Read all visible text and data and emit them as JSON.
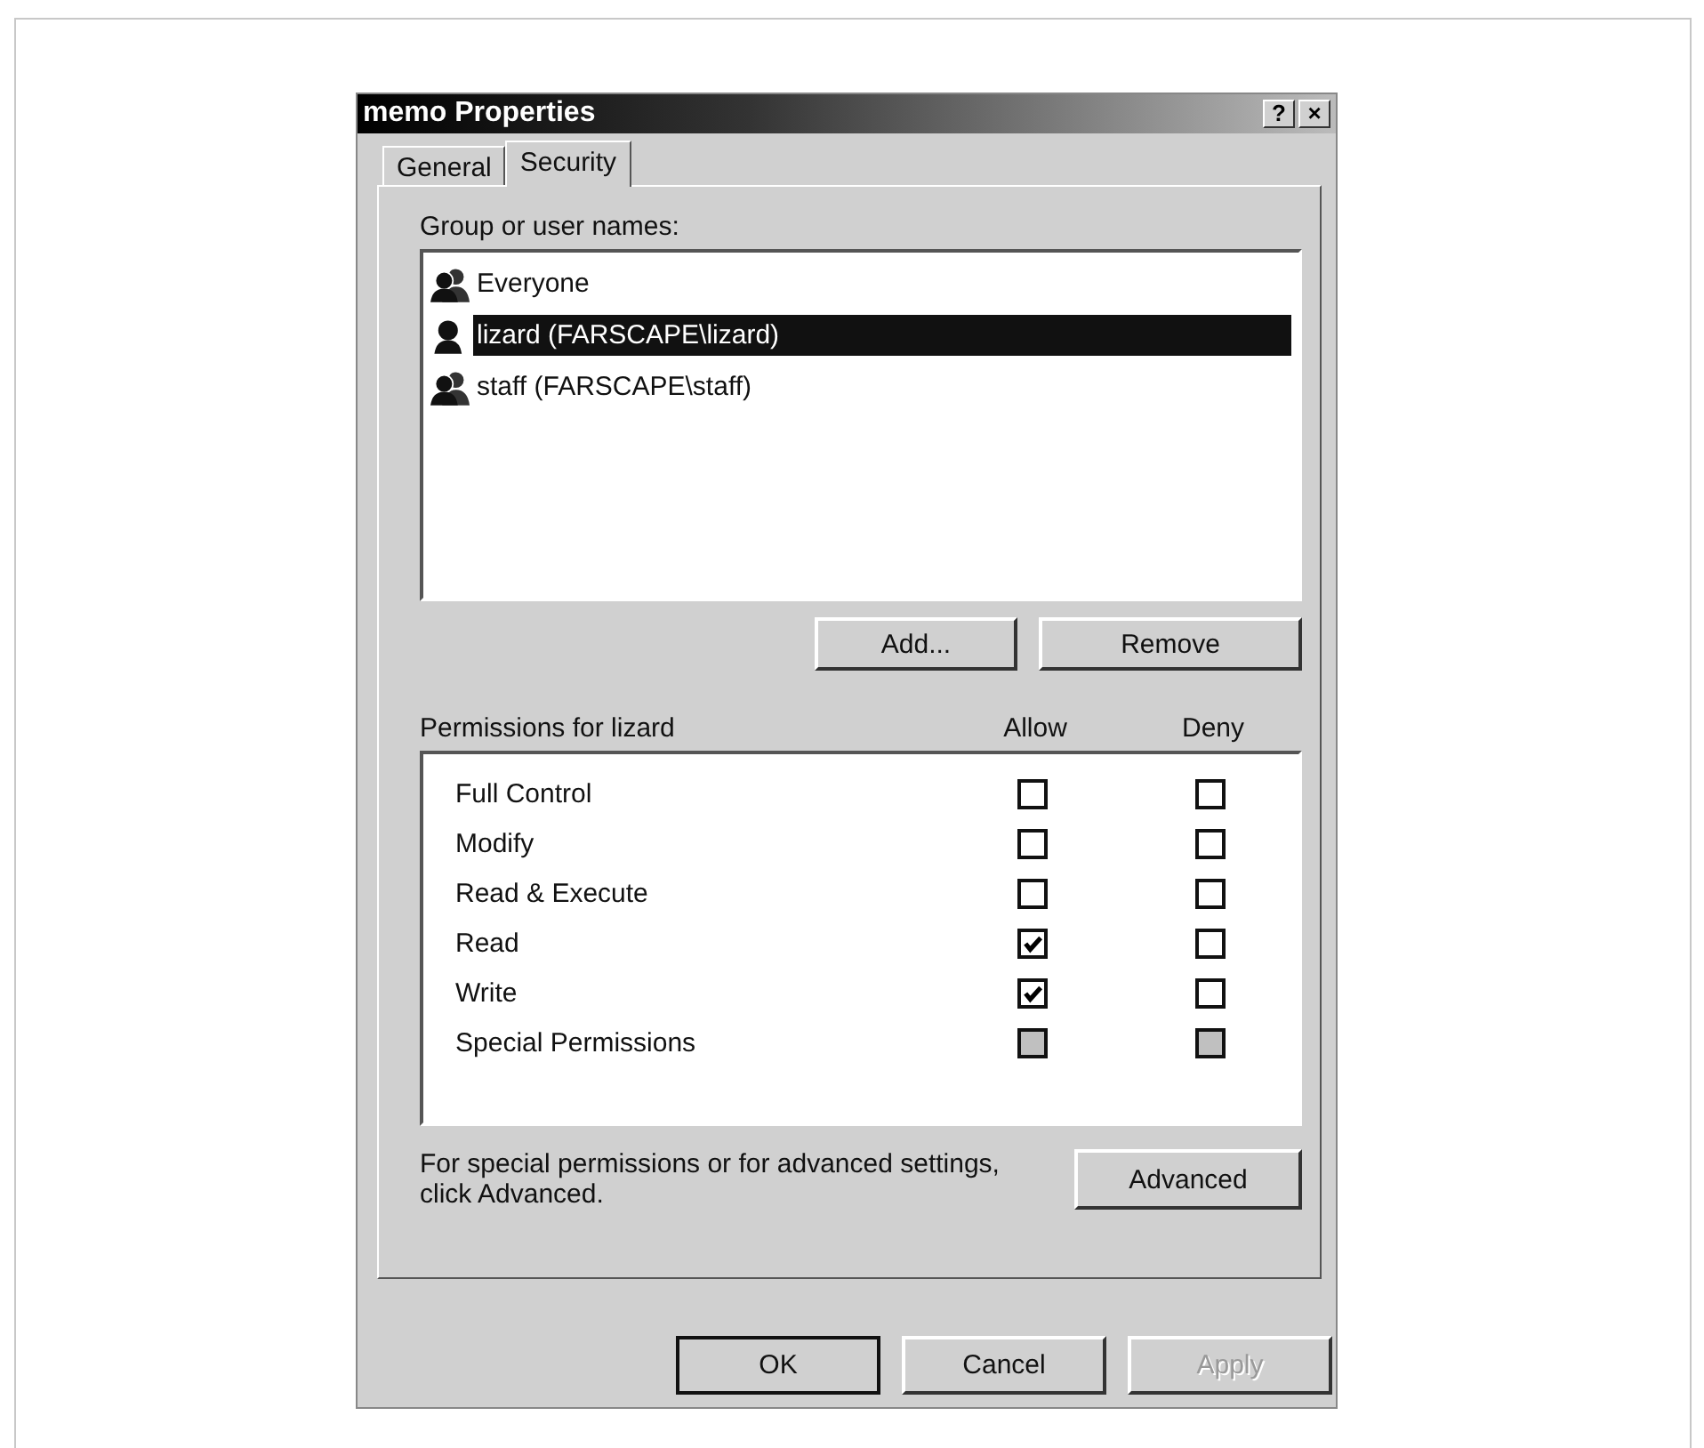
{
  "window": {
    "title": "memo Properties",
    "title_buttons": [
      "?",
      "×"
    ]
  },
  "tabs": [
    {
      "label": "General",
      "selected": false
    },
    {
      "label": "Security",
      "selected": true
    }
  ],
  "users": {
    "label": "Group or user names:",
    "items": [
      {
        "name": "Everyone",
        "kind": "group",
        "selected": false
      },
      {
        "name": "lizard (FARSCAPE\\lizard)",
        "kind": "user",
        "selected": true
      },
      {
        "name": "staff (FARSCAPE\\staff)",
        "kind": "group",
        "selected": false
      }
    ],
    "buttons": [
      "Add...",
      "Remove"
    ]
  },
  "permissions": {
    "label": "Permissions for lizard",
    "columns": [
      "Allow",
      "Deny"
    ],
    "rows": [
      {
        "name": "Full Control",
        "allow": {
          "checked": false,
          "disabled": false
        },
        "deny": {
          "checked": false,
          "disabled": false
        }
      },
      {
        "name": "Modify",
        "allow": {
          "checked": false,
          "disabled": false
        },
        "deny": {
          "checked": false,
          "disabled": false
        }
      },
      {
        "name": "Read & Execute",
        "allow": {
          "checked": false,
          "disabled": false
        },
        "deny": {
          "checked": false,
          "disabled": false
        }
      },
      {
        "name": "Read",
        "allow": {
          "checked": true,
          "disabled": false
        },
        "deny": {
          "checked": false,
          "disabled": false
        }
      },
      {
        "name": "Write",
        "allow": {
          "checked": true,
          "disabled": false
        },
        "deny": {
          "checked": false,
          "disabled": false
        }
      },
      {
        "name": "Special Permissions",
        "allow": {
          "checked": false,
          "disabled": true
        },
        "deny": {
          "checked": false,
          "disabled": true
        }
      }
    ]
  },
  "advanced": {
    "text": "For special permissions or for advanced settings, click Advanced.",
    "button": "Advanced"
  },
  "footer_buttons": [
    {
      "label": "OK",
      "default": true,
      "disabled": false
    },
    {
      "label": "Cancel",
      "default": false,
      "disabled": false
    },
    {
      "label": "Apply",
      "default": false,
      "disabled": true
    }
  ]
}
